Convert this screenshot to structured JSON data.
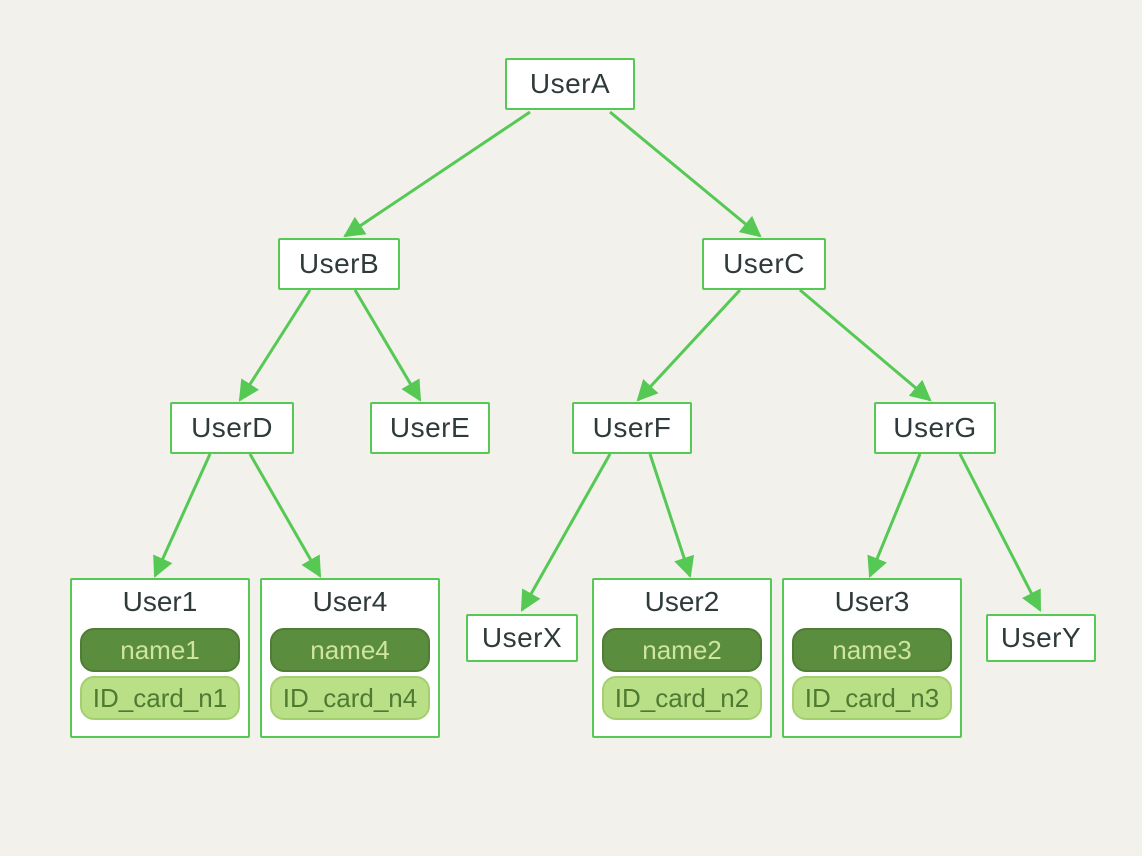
{
  "nodes": {
    "A": "UserA",
    "B": "UserB",
    "C": "UserC",
    "D": "UserD",
    "E": "UserE",
    "F": "UserF",
    "G": "UserG",
    "X": "UserX",
    "Y": "UserY"
  },
  "leaves": {
    "u1": {
      "title": "User1",
      "name": "name1",
      "id": "ID_card_n1"
    },
    "u4": {
      "title": "User4",
      "name": "name4",
      "id": "ID_card_n4"
    },
    "u2": {
      "title": "User2",
      "name": "name2",
      "id": "ID_card_n2"
    },
    "u3": {
      "title": "User3",
      "name": "name3",
      "id": "ID_card_n3"
    }
  },
  "tree": {
    "root": "UserA",
    "children": {
      "UserA": [
        "UserB",
        "UserC"
      ],
      "UserB": [
        "UserD",
        "UserE"
      ],
      "UserC": [
        "UserF",
        "UserG"
      ],
      "UserD": [
        "User1",
        "User4"
      ],
      "UserF": [
        "UserX",
        "User2"
      ],
      "UserG": [
        "User3",
        "UserY"
      ]
    }
  },
  "colors": {
    "stroke": "#55c954",
    "node_text": "#2f3a3a",
    "pill_dark_bg": "#5b8d3f",
    "pill_dark_text": "#cfe59e",
    "pill_light_bg": "#b9df87",
    "pill_light_text": "#4e7a32",
    "canvas_bg": "#f2f1ec"
  }
}
